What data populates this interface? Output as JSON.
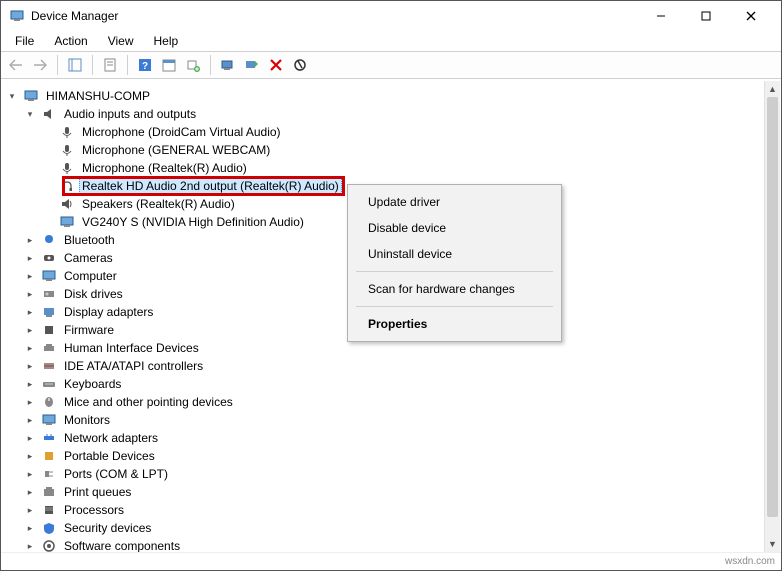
{
  "window": {
    "title": "Device Manager"
  },
  "menubar": {
    "file": "File",
    "action": "Action",
    "view": "View",
    "help": "Help"
  },
  "tree": {
    "root": "HIMANSHU-COMP",
    "audio": {
      "label": "Audio inputs and outputs",
      "items": [
        "Microphone (DroidCam Virtual Audio)",
        "Microphone (GENERAL WEBCAM)",
        "Microphone (Realtek(R) Audio)",
        "Realtek HD Audio 2nd output (Realtek(R) Audio)",
        "Speakers (Realtek(R) Audio)",
        "VG240Y S (NVIDIA High Definition Audio)"
      ]
    },
    "categories": [
      "Bluetooth",
      "Cameras",
      "Computer",
      "Disk drives",
      "Display adapters",
      "Firmware",
      "Human Interface Devices",
      "IDE ATA/ATAPI controllers",
      "Keyboards",
      "Mice and other pointing devices",
      "Monitors",
      "Network adapters",
      "Portable Devices",
      "Ports (COM & LPT)",
      "Print queues",
      "Processors",
      "Security devices",
      "Software components"
    ]
  },
  "context_menu": {
    "update": "Update driver",
    "disable": "Disable device",
    "uninstall": "Uninstall device",
    "scan": "Scan for hardware changes",
    "properties": "Properties"
  },
  "status": {
    "watermark": "wsxdn.com"
  }
}
